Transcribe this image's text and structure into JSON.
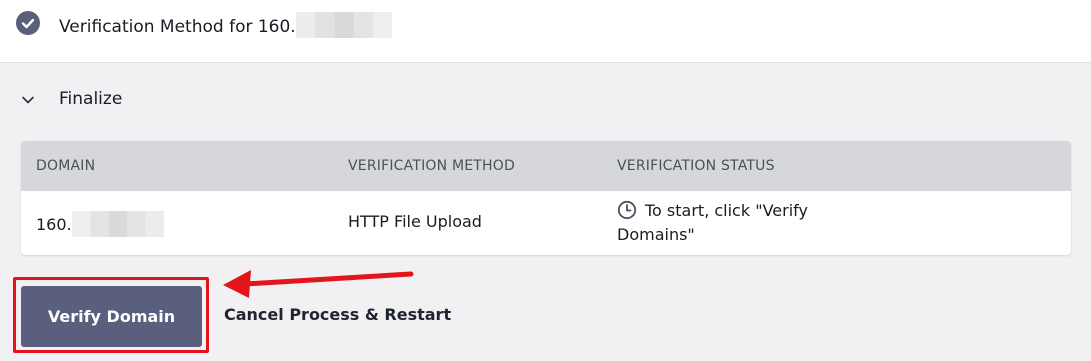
{
  "step": {
    "title_prefix": "Verification Method for 160."
  },
  "finalize": {
    "label": "Finalize"
  },
  "table": {
    "headers": [
      "DOMAIN",
      "VERIFICATION METHOD",
      "VERIFICATION STATUS"
    ],
    "rows": [
      {
        "domain_prefix": "160.",
        "method": "HTTP File Upload",
        "status": "To start, click \"Verify Domains\""
      }
    ]
  },
  "actions": {
    "verify_label": "Verify Domain",
    "cancel_label": "Cancel Process & Restart"
  },
  "colors": {
    "primary_button": "#5a5f7d",
    "annotation_red": "#e3151a",
    "header_bg": "#d6d7da"
  },
  "icons": {
    "step_complete": "check-circle-icon",
    "collapse": "chevron-down-icon",
    "status": "clock-icon"
  }
}
